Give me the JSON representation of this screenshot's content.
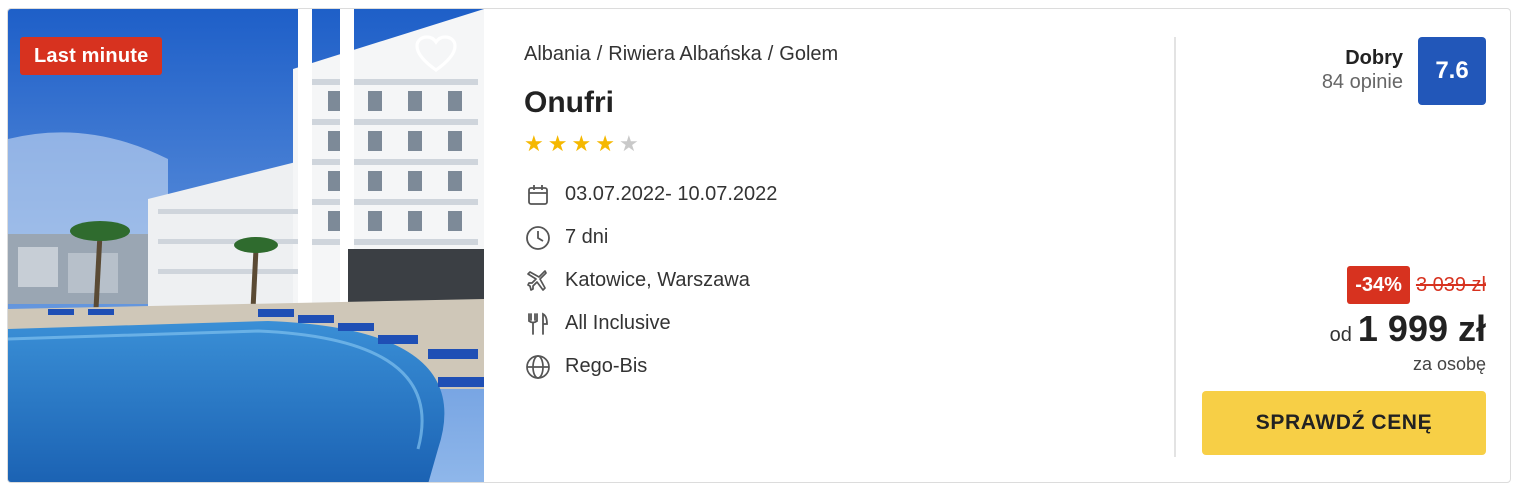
{
  "photo": {
    "badge": "Last minute",
    "favorite_icon": "heart-outline-icon"
  },
  "breadcrumb": {
    "country": "Albania",
    "region": "Riwiera Albańska",
    "city": "Golem",
    "separator": "/"
  },
  "hotel": {
    "name": "Onufri",
    "stars": 4,
    "max_stars": 5
  },
  "details": {
    "dates": {
      "icon": "calendar-icon",
      "text": "03.07.2022- 10.07.2022"
    },
    "duration": {
      "icon": "clock-icon",
      "text": "7 dni"
    },
    "departure": {
      "icon": "plane-icon",
      "text": "Katowice, Warszawa"
    },
    "board": {
      "icon": "cutlery-icon",
      "text": "All Inclusive"
    },
    "operator": {
      "icon": "globe-icon",
      "text": "Rego-Bis"
    }
  },
  "rating": {
    "word": "Dobry",
    "count": "84 opinie",
    "score": "7.6"
  },
  "price": {
    "discount": "-34%",
    "old": "3 039 zł",
    "from": "od",
    "value": "1 999 zł",
    "per": "za osobę"
  },
  "cta": {
    "label": "SPRAWDŹ CENĘ"
  },
  "colors": {
    "badge_red": "#d7321f",
    "rating_blue": "#2257b9",
    "cta_yellow": "#f7cf46",
    "star_gold": "#f5b800"
  }
}
